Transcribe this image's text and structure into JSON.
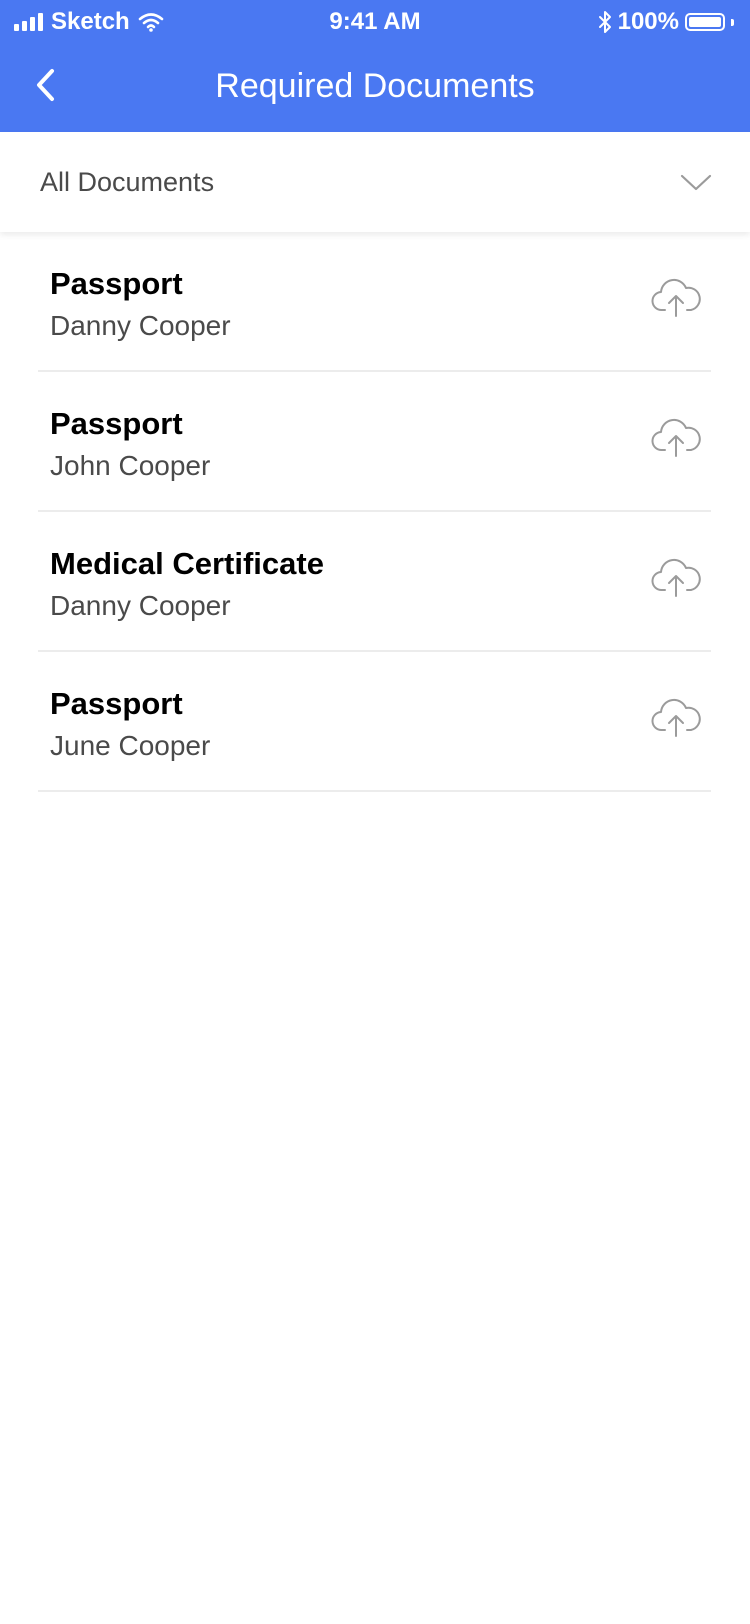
{
  "status_bar": {
    "carrier": "Sketch",
    "time": "9:41 AM",
    "battery": "100%",
    "icons": [
      "signal-icon",
      "wifi-icon",
      "bluetooth-icon",
      "battery-icon"
    ]
  },
  "nav": {
    "title": "Required Documents",
    "back_icon": "chevron-left-icon"
  },
  "filter": {
    "label": "All Documents",
    "icon": "chevron-down-icon"
  },
  "documents": [
    {
      "title": "Passport",
      "owner": "Danny Cooper",
      "action_icon": "cloud-upload-icon"
    },
    {
      "title": "Passport",
      "owner": "John Cooper",
      "action_icon": "cloud-upload-icon"
    },
    {
      "title": "Medical Certificate",
      "owner": "Danny Cooper",
      "action_icon": "cloud-upload-icon"
    },
    {
      "title": "Passport",
      "owner": "June Cooper",
      "action_icon": "cloud-upload-icon"
    }
  ],
  "colors": {
    "header": "#4a78f2",
    "title_text": "#000000",
    "secondary_text": "#4a4a4a",
    "divider": "#ececec",
    "icon": "#9b9b9b"
  }
}
